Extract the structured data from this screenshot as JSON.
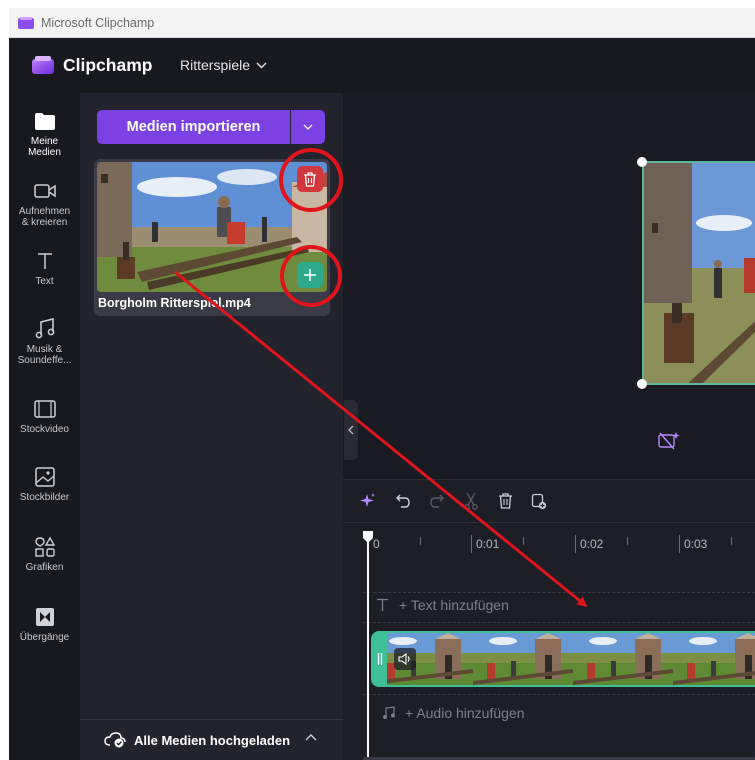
{
  "window": {
    "title": "Microsoft Clipchamp"
  },
  "header": {
    "brand": "Clipchamp",
    "project_name": "Ritterspiele"
  },
  "nav": [
    {
      "key": "media",
      "label": "Meine\nMedien",
      "icon": "folder-icon"
    },
    {
      "key": "record",
      "label": "Aufnehmen\n& kreieren",
      "icon": "video-camera-icon"
    },
    {
      "key": "text",
      "label": "Text",
      "icon": "text-icon"
    },
    {
      "key": "music",
      "label": "Musik &\nSoundeffe...",
      "icon": "music-note-icon"
    },
    {
      "key": "stockvideo",
      "label": "Stockvideo",
      "icon": "film-icon"
    },
    {
      "key": "stockimages",
      "label": "Stockbilder",
      "icon": "image-icon"
    },
    {
      "key": "graphics",
      "label": "Grafiken",
      "icon": "shapes-icon"
    },
    {
      "key": "transitions",
      "label": "Übergänge",
      "icon": "transition-icon"
    }
  ],
  "media_panel": {
    "import_label": "Medien importieren",
    "file_name": "Borgholm Ritterspiel.mp4",
    "footer_status": "Alle Medien hochgeladen"
  },
  "timeline": {
    "ruler_labels": [
      "0",
      "0:01",
      "0:02",
      "0:03"
    ],
    "text_track_label": "+ Text hinzufügen",
    "audio_track_label": "+ Audio hinzufügen"
  },
  "colors": {
    "accent": "#7b41e4",
    "delete": "#d0383d",
    "add": "#2ea98b",
    "clip_border": "#3fbf95",
    "annotation_red": "#e0141b"
  }
}
